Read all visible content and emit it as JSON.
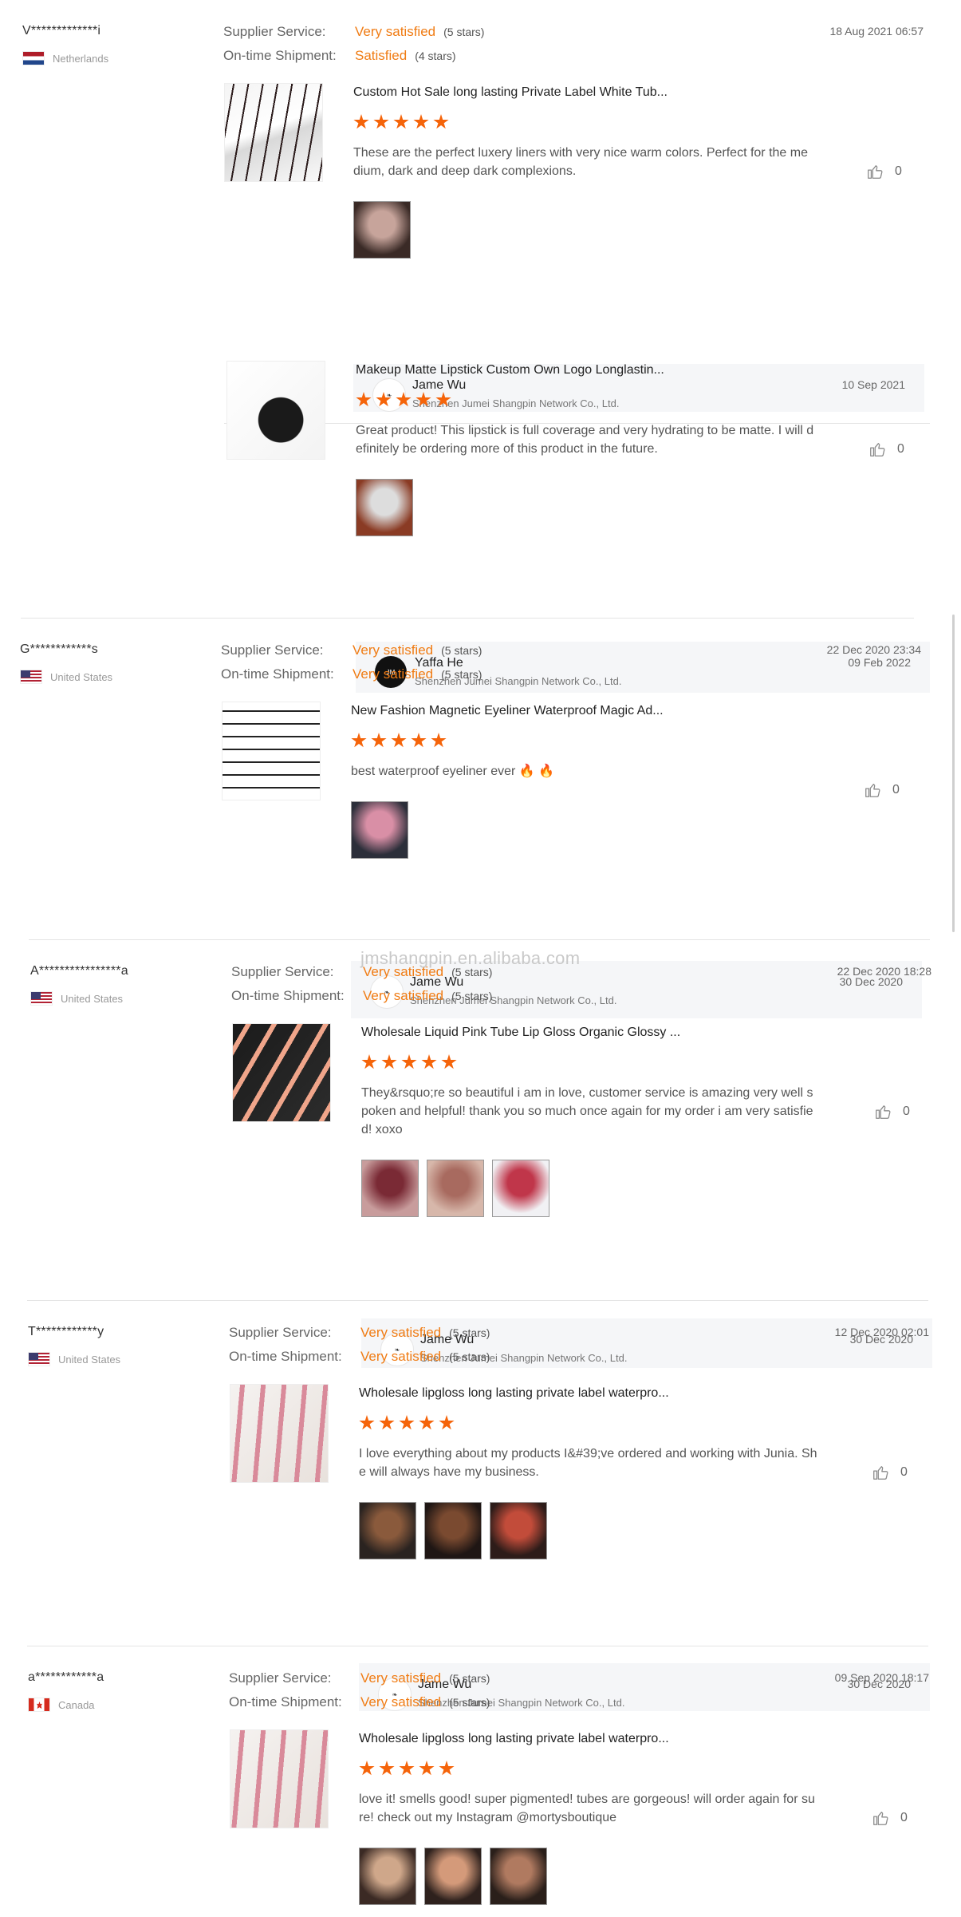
{
  "labels": {
    "supplier_service": "Supplier Service:",
    "ontime_shipment": "On-time Shipment:"
  },
  "watermark": "jmshangpin.en.alibaba.com",
  "colors": {
    "accent": "#f07c14",
    "star": "#f5640a",
    "reply_bg": "#f5f6f8"
  },
  "reviews": [
    {
      "buyer": "V*************i",
      "country": "Netherlands",
      "supplier_service": "Very satisfied",
      "supplier_stars": "(5 stars)",
      "shipment": "Satisfied",
      "shipment_stars": "(4 stars)",
      "date": "18 Aug 2021 06:57",
      "items": [
        {
          "title": "Custom Hot Sale long lasting Private Label White Tub...",
          "rating": 5,
          "comment": "These are the perfect luxery liners with very nice warm colors. Perfect for the medium, dark and deep dark complexions.",
          "likes": "0",
          "photos": [
            "swatch-photo"
          ],
          "reply": {
            "name": "Jame Wu",
            "company": "Shenzhen Jumei Shangpin Network Co., Ltd.",
            "date": "10 Sep 2021"
          }
        },
        {
          "title": "Makeup Matte Lipstick Custom Own Logo Longlastin...",
          "rating": 5,
          "comment": "Great product! This lipstick is full coverage and very hydrating to be matte. I will definitely be ordering more of this product in the future.",
          "likes": "0",
          "photos": [
            "flowers-photo"
          ],
          "reply": {
            "name": "Yaffa He",
            "company": "Shenzhen Jumei Shangpin Network Co., Ltd.",
            "date": "09 Feb 2022"
          }
        }
      ]
    },
    {
      "buyer": "G************s",
      "country": "United States",
      "supplier_service": "Very satisfied",
      "supplier_stars": "(5 stars)",
      "shipment": "Very satisfied",
      "shipment_stars": "(5 stars)",
      "date": "22 Dec 2020 23:34",
      "items": [
        {
          "title": "New Fashion Magnetic Eyeliner Waterproof Magic Ad...",
          "rating": 5,
          "comment": "best waterproof eyeliner ever 🔥 🔥",
          "likes": "0",
          "photos": [
            "eyeliner-photo"
          ],
          "reply": {
            "name": "Jame Wu",
            "company": "Shenzhen Jumei Shangpin Network Co., Ltd.",
            "date": "30 Dec 2020"
          }
        }
      ]
    },
    {
      "buyer": "A****************a",
      "country": "United States",
      "supplier_service": "Very satisfied",
      "supplier_stars": "(5 stars)",
      "shipment": "Very satisfied",
      "shipment_stars": "(5 stars)",
      "date": "22 Dec 2020 18:28",
      "items": [
        {
          "title": "Wholesale Liquid Pink Tube Lip Gloss Organic Glossy ...",
          "rating": 5,
          "comment": "They&rsquo;re so beautiful i am in love, customer service is amazing very well spoken and helpful! thank you so much once again for my order i am very satisfied! xoxo",
          "likes": "0",
          "photos": [
            "gloss-photo-1",
            "gloss-photo-2",
            "gloss-photo-3"
          ],
          "reply": {
            "name": "Jame Wu",
            "company": "Shenzhen Jumei Shangpin Network Co., Ltd.",
            "date": "30 Dec 2020"
          }
        }
      ]
    },
    {
      "buyer": "T************y",
      "country": "United States",
      "supplier_service": "Very satisfied",
      "supplier_stars": "(5 stars)",
      "shipment": "Very satisfied",
      "shipment_stars": "(5 stars)",
      "date": "12 Dec 2020 02:01",
      "items": [
        {
          "title": "Wholesale lipgloss long lasting private label waterpro...",
          "rating": 5,
          "comment": "I love everything about my products I&#39;ve ordered and working with Junia. She will always have my business.",
          "likes": "0",
          "photos": [
            "model-photo-1",
            "model-photo-2",
            "model-photo-3"
          ],
          "reply": {
            "name": "Jame Wu",
            "company": "Shenzhen Jumei Shangpin Network Co., Ltd.",
            "date": "30 Dec 2020"
          }
        }
      ]
    },
    {
      "buyer": "a************a",
      "country": "Canada",
      "supplier_service": "Very satisfied",
      "supplier_stars": "(5 stars)",
      "shipment": "Very satisfied",
      "shipment_stars": "(5 stars)",
      "date": "09 Sep 2020 18:17",
      "items": [
        {
          "title": "Wholesale lipgloss long lasting private label waterpro...",
          "rating": 5,
          "comment": "love it! smells good! super pigmented! tubes are gorgeous! will order again for sure! check out my Instagram @mortysboutique",
          "likes": "0",
          "photos": [
            "selfie-photo-1",
            "selfie-photo-2",
            "selfie-photo-3"
          ]
        }
      ]
    }
  ]
}
